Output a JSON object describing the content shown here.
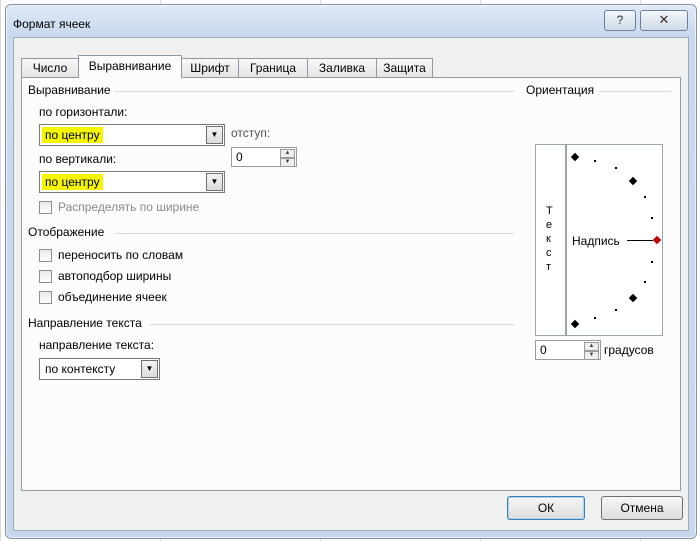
{
  "window": {
    "title": "Формат ячеек",
    "help_label": "?",
    "close_label": "✕"
  },
  "tabs": [
    {
      "label": "Число"
    },
    {
      "label": "Выравнивание"
    },
    {
      "label": "Шрифт"
    },
    {
      "label": "Граница"
    },
    {
      "label": "Заливка"
    },
    {
      "label": "Защита"
    }
  ],
  "alignment": {
    "group_title": "Выравнивание",
    "horizontal_label": "по горизонтали:",
    "horizontal_value": "по центру",
    "indent_label": "отступ:",
    "indent_value": "0",
    "vertical_label": "по вертикали:",
    "vertical_value": "по центру",
    "distribute_label": "Распределять по ширине",
    "highlight_color": "#f5f500"
  },
  "display": {
    "group_title": "Отображение",
    "wrap_label": "переносить по словам",
    "autofit_label": "автоподбор ширины",
    "merge_label": "объединение ячеек"
  },
  "text_direction": {
    "group_title": "Направление текста",
    "direction_label": "направление текста:",
    "direction_value": "по контексту"
  },
  "orientation": {
    "group_title": "Ориентация",
    "vertical_letters": [
      "Т",
      "е",
      "к",
      "с",
      "т"
    ],
    "label_text": "Надпись",
    "degrees_value": "0",
    "degrees_label": "градусов",
    "marker_color": "#c00000"
  },
  "buttons": {
    "ok_label": "ОК",
    "cancel_label": "Отмена"
  }
}
